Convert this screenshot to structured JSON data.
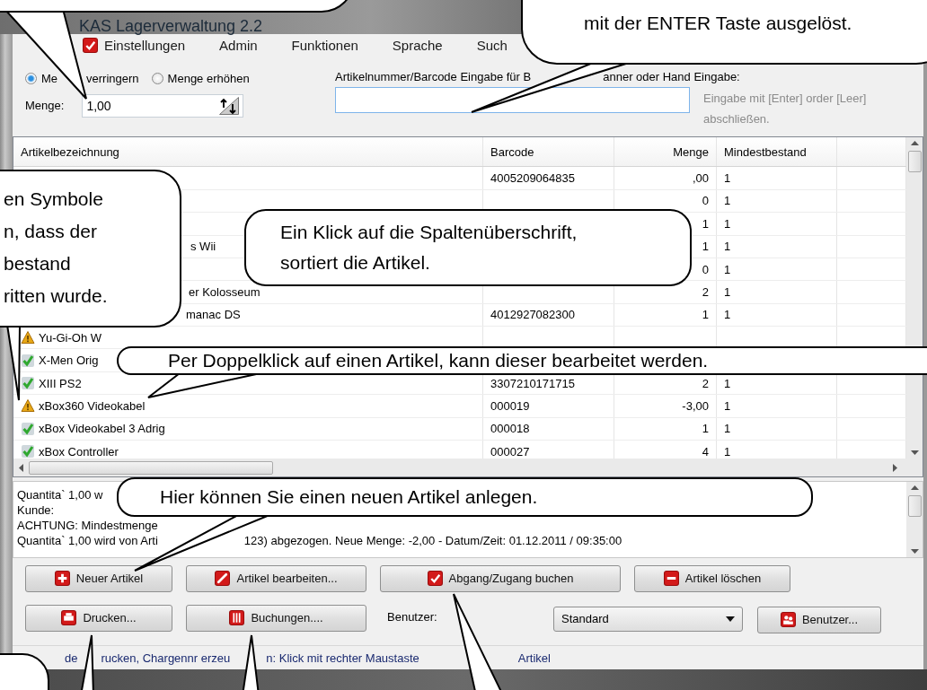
{
  "window": {
    "title": "KAS Lagerverwaltung 2.2"
  },
  "menu": [
    {
      "label": "Einstellungen"
    },
    {
      "label": "Admin"
    },
    {
      "label": "Funktionen"
    },
    {
      "label": "Sprache"
    },
    {
      "label": "Such"
    }
  ],
  "quantity_mode": [
    {
      "label_parts": [
        "Me",
        "verringern"
      ],
      "selected": true
    },
    {
      "label_parts": [
        "Menge erhöhen"
      ],
      "selected": false
    }
  ],
  "quantity": {
    "label": "Menge:",
    "value": "1,00"
  },
  "barcode_input": {
    "label_parts": [
      "Artikelnummer/Barcode Eingabe für B",
      "anner oder Hand Eingabe:"
    ],
    "hint": "Eingabe mit [Enter] order [Leer] abschließen."
  },
  "table": {
    "columns": [
      "Artikelbezeichnung",
      "Barcode",
      "Menge",
      "Mindestbestand"
    ],
    "rows": [
      {
        "barcode": "4005209064835",
        "quantity": ",00",
        "minimum": "1"
      },
      {
        "quantity": "0",
        "minimum": "1"
      },
      {
        "quantity": "1",
        "minimum": "1"
      },
      {
        "name": "s Wii",
        "quantity": "1",
        "minimum": "1"
      },
      {
        "quantity": "0",
        "minimum": "1"
      },
      {
        "name": "er Kolosseum",
        "quantity": "2",
        "minimum": "1"
      },
      {
        "name": "manac DS",
        "barcode": "4012927082300",
        "quantity": "1",
        "minimum": "1"
      },
      {
        "kind": "warn",
        "name": "Yu-Gi-Oh W"
      },
      {
        "kind": "ok",
        "name": "X-Men Orig"
      },
      {
        "kind": "ok",
        "name": "XIII PS2",
        "barcode": "3307210171715",
        "quantity": "2",
        "minimum": "1"
      },
      {
        "kind": "warn",
        "name": "xBox360 Videokabel",
        "barcode": "000019",
        "quantity": "-3,00",
        "minimum": "1"
      },
      {
        "kind": "ok",
        "name": "xBox Videokabel 3 Adrig",
        "barcode": "000018",
        "quantity": "1",
        "minimum": "1"
      },
      {
        "kind": "ok",
        "name": "xBox Controller",
        "barcode": "000027",
        "quantity": "4",
        "minimum": "1"
      }
    ]
  },
  "log": [
    {
      "parts": [
        "Quantita` 1,00 w"
      ]
    },
    {
      "parts": [
        "Kunde:"
      ]
    },
    {
      "parts": [
        "ACHTUNG: Mindestmenge"
      ]
    },
    {
      "parts": [
        "Quantita` 1,00 wird von Arti",
        "123) abgezogen. Neue Menge: -2,00 - Datum/Zeit: 01.12.2011 / 09:35:00"
      ]
    }
  ],
  "buttons": [
    {
      "label": "Neuer Artikel"
    },
    {
      "label": "Artikel bearbeiten..."
    },
    {
      "label": "Abgang/Zugang buchen"
    },
    {
      "label": "Artikel löschen"
    }
  ],
  "buttons_2": [
    {
      "label": "Drucken..."
    },
    {
      "label": "Buchungen...."
    }
  ],
  "user": {
    "label": "Benutzer:",
    "value": "Standard",
    "button": {
      "label": "Benutzer..."
    }
  },
  "status_bar": {
    "parts": [
      "de",
      "rucken, Chargennr erzeu",
      "n: Klick mit rechter Maustaste",
      "Artikel"
    ]
  },
  "callouts": [
    {
      "lines": [
        "mit der ENTER Taste ausgelöst."
      ]
    },
    {
      "lines": [
        "en Symbole",
        "n, dass der",
        "bestand",
        "ritten wurde."
      ]
    },
    {
      "lines": [
        "Ein Klick auf die Spaltenüberschrift,",
        "sortiert die Artikel."
      ]
    },
    {
      "lines": [
        "Per Doppelklick auf einen Artikel, kann dieser bearbeitet werden."
      ]
    },
    {
      "lines": [
        "Hier können Sie einen neuen Artikel anlegen."
      ]
    }
  ]
}
